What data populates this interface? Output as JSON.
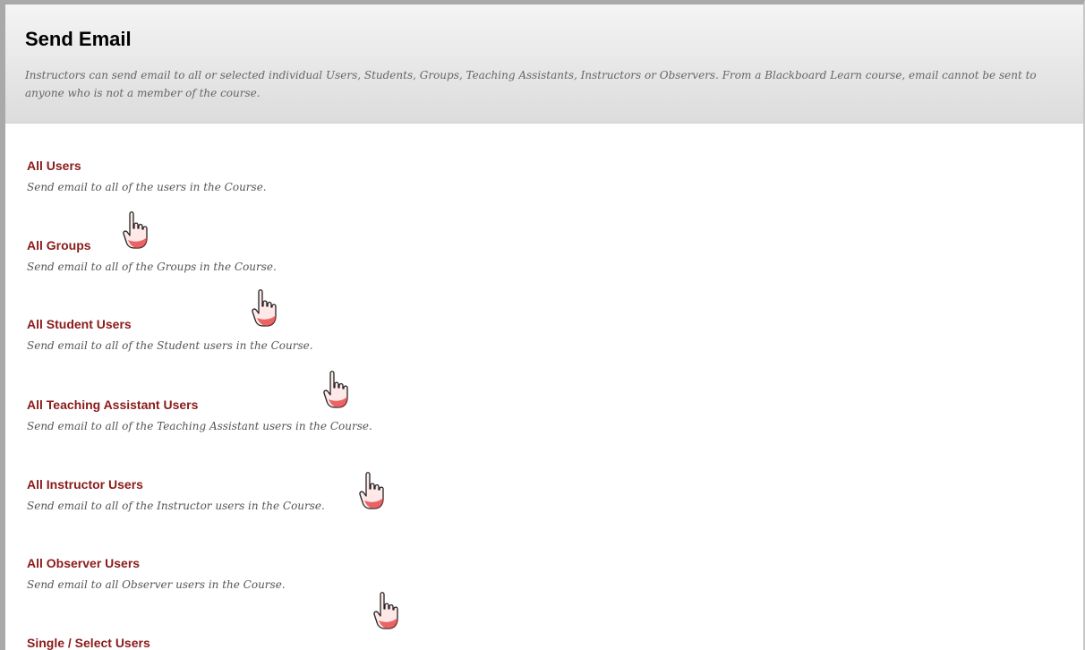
{
  "page": {
    "title": "Send Email",
    "description": "Instructors can send email to all or selected individual Users, Students, Groups, Teaching Assistants, Instructors or Observers. From a Blackboard Learn course, email cannot be sent to anyone who is not a member of the course."
  },
  "options": [
    {
      "label": "All Users",
      "desc": "Send email to all of the users in the Course."
    },
    {
      "label": "All Groups",
      "desc": "Send email to all of the Groups in the Course."
    },
    {
      "label": "All Student Users",
      "desc": "Send email to all of the Student users in the Course."
    },
    {
      "label": "All Teaching Assistant Users",
      "desc": "Send email to all of the Teaching Assistant users in the Course."
    },
    {
      "label": "All Instructor Users",
      "desc": "Send email to all of the Instructor users in the Course."
    },
    {
      "label": "All Observer Users",
      "desc": "Send email to all Observer users in the Course."
    },
    {
      "label": "Single / Select Users",
      "desc": ""
    }
  ],
  "colors": {
    "link": "#8b1a1a",
    "header_bg": "#e9e9e9",
    "hand_cuff": "#e23a3a"
  },
  "icons": {
    "pointer": "hand-pointer-icon"
  }
}
